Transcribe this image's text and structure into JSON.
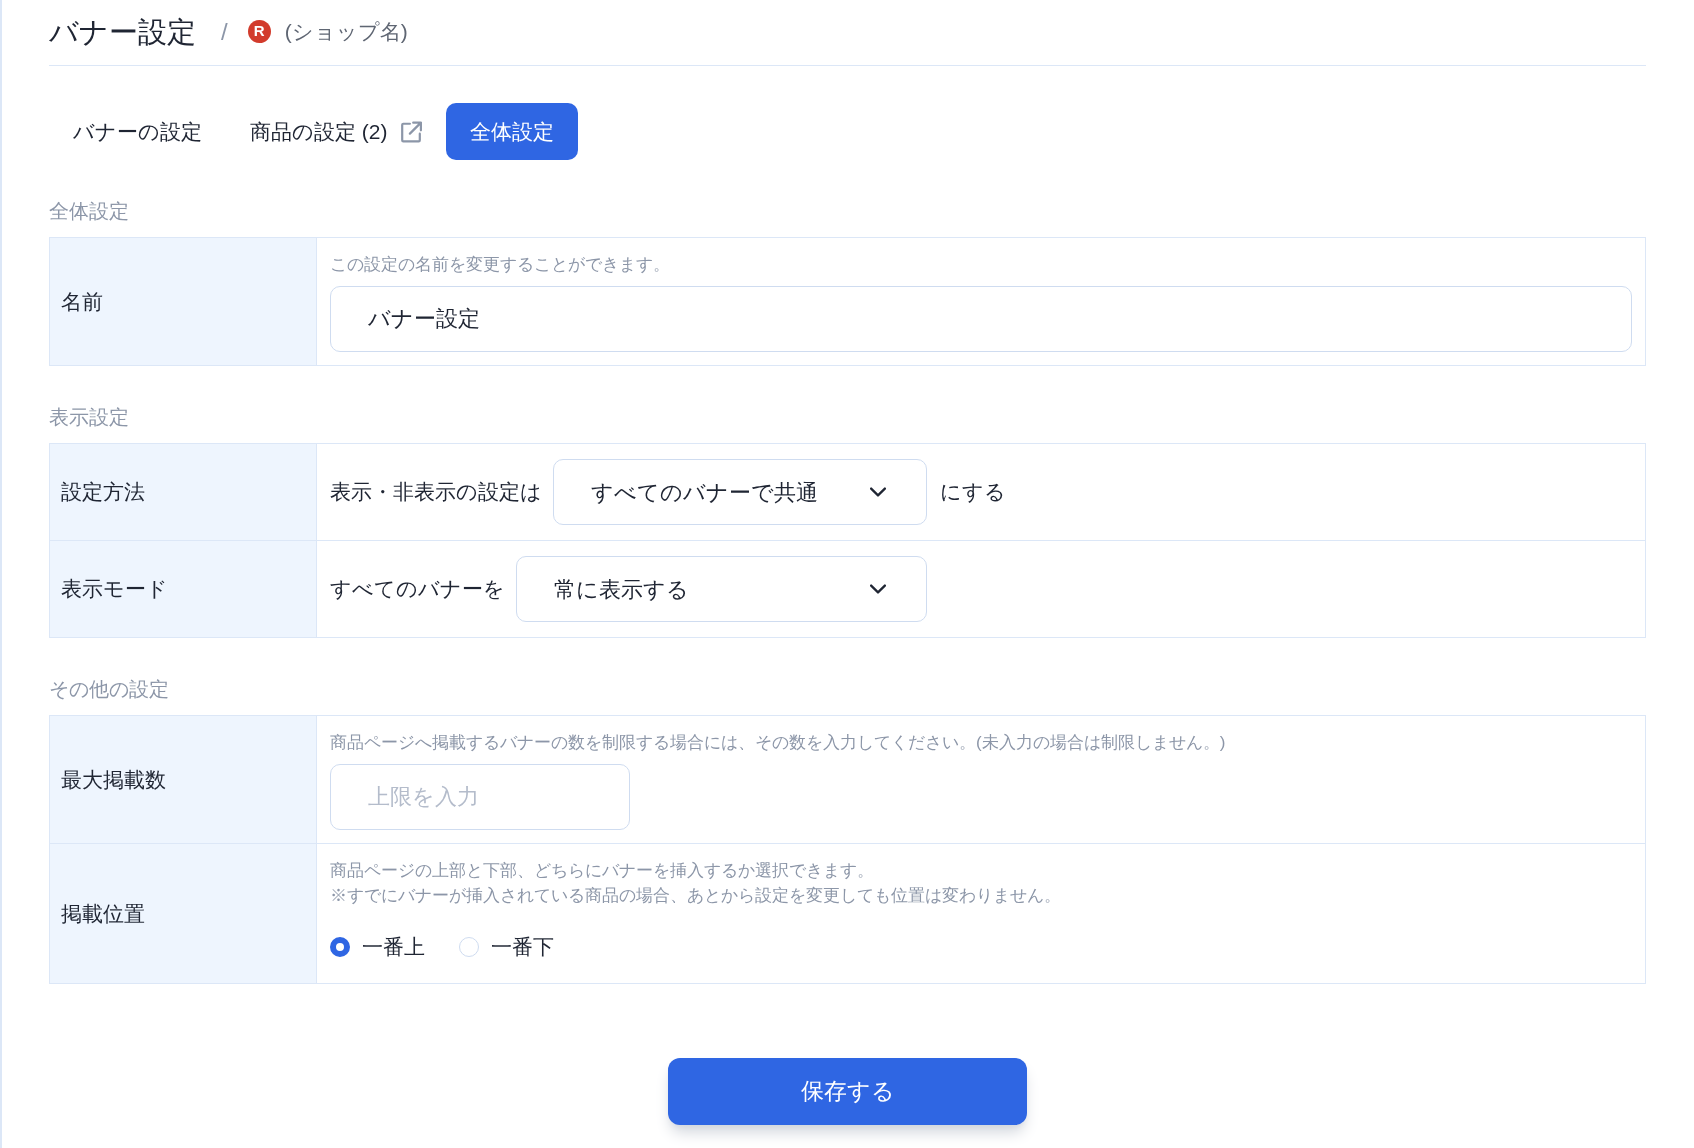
{
  "header": {
    "title": "バナー設定",
    "separator": "/",
    "logo_letter": "R",
    "shop_name": "(ショップ名)"
  },
  "tabs": [
    {
      "label": "バナーの設定",
      "selected": false,
      "external": false
    },
    {
      "label": "商品の設定 (2)",
      "selected": false,
      "external": true
    },
    {
      "label": "全体設定",
      "selected": true,
      "external": false
    }
  ],
  "sections": [
    {
      "title": "全体設定",
      "rows": [
        {
          "label": "名前",
          "kind": "text_input",
          "hint_lines": [
            "この設定の名前を変更することができます。"
          ],
          "value": "バナー設定"
        }
      ]
    },
    {
      "title": "表示設定",
      "rows": [
        {
          "label": "設定方法",
          "kind": "select",
          "prefix": "表示・非表示の設定は",
          "value": "すべてのバナーで共通",
          "suffix": "にする"
        },
        {
          "label": "表示モード",
          "kind": "select",
          "prefix": "すべてのバナーを",
          "value": "常に表示する"
        }
      ]
    },
    {
      "title": "その他の設定",
      "rows": [
        {
          "label": "最大掲載数",
          "kind": "number_input",
          "hint_lines": [
            "商品ページへ掲載するバナーの数を制限する場合には、その数を入力してください。(未入力の場合は制限しません。)"
          ],
          "placeholder": "上限を入力"
        },
        {
          "label": "掲載位置",
          "kind": "radio",
          "hint_lines": [
            "商品ページの上部と下部、どちらにバナーを挿入するか選択できます。",
            "※すでにバナーが挿入されている商品の場合、あとから設定を変更しても位置は変わりません。"
          ],
          "options": [
            {
              "label": "一番上",
              "selected": true
            },
            {
              "label": "一番下",
              "selected": false
            }
          ]
        }
      ]
    }
  ],
  "save_button": "保存する"
}
